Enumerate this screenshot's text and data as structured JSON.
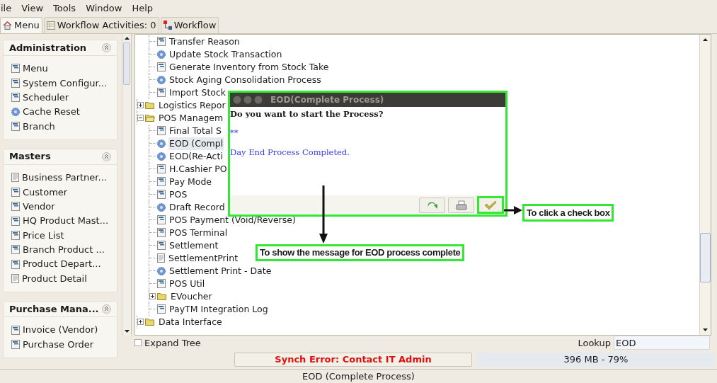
{
  "menu_bar": [
    "ile",
    "View",
    "Tools",
    "Window",
    "Help"
  ],
  "tabs": [
    {
      "label": "Menu",
      "kind": "home",
      "selected": true
    },
    {
      "label": "Workflow Activities: 0",
      "kind": "table",
      "selected": false
    },
    {
      "label": "Workflow",
      "kind": "workflow",
      "selected": false
    }
  ],
  "sidebar": [
    {
      "title": "Administration",
      "expanded": true,
      "items": [
        {
          "label": "Menu",
          "kind": "form"
        },
        {
          "label": "System Configur...",
          "kind": "form"
        },
        {
          "label": "Scheduler",
          "kind": "form"
        },
        {
          "label": "Cache Reset",
          "kind": "process"
        },
        {
          "label": "Branch",
          "kind": "form"
        }
      ]
    },
    {
      "title": "Masters",
      "expanded": true,
      "items": [
        {
          "label": "Business Partner...",
          "kind": "report"
        },
        {
          "label": "Customer",
          "kind": "form"
        },
        {
          "label": "Vendor",
          "kind": "form"
        },
        {
          "label": "HQ Product Mast...",
          "kind": "form"
        },
        {
          "label": "Price List",
          "kind": "form"
        },
        {
          "label": "Branch Product ...",
          "kind": "form"
        },
        {
          "label": "Product Depart...",
          "kind": "form"
        },
        {
          "label": "Product Detail",
          "kind": "report"
        }
      ]
    },
    {
      "title": "Purchase Mana...",
      "expanded": true,
      "items": [
        {
          "label": "Invoice (Vendor)",
          "kind": "form"
        },
        {
          "label": "Purchase Order",
          "kind": "form"
        }
      ]
    }
  ],
  "tree": {
    "continued_items": [
      {
        "label": "Transfer Reason",
        "kind": "form",
        "selected": false
      },
      {
        "label": "Update Stock Transaction",
        "kind": "process",
        "selected": false
      },
      {
        "label": "Generate Inventory from Stock Take",
        "kind": "form",
        "selected": false
      },
      {
        "label": "Stock Aging Consolidation Process",
        "kind": "process",
        "selected": false
      },
      {
        "label": "Import Stock",
        "kind": "form",
        "selected": false
      }
    ],
    "nodes": [
      {
        "label": "Logistics Repor",
        "kind": "folder",
        "expanded": false,
        "selected": false
      },
      {
        "label": "POS Managem",
        "kind": "folder",
        "expanded": true,
        "selected": false,
        "children": [
          {
            "label": "Final Total S",
            "kind": "form",
            "selected": false
          },
          {
            "label": "EOD (Compl",
            "kind": "process",
            "selected": true
          },
          {
            "label": "EOD(Re-Acti",
            "kind": "process",
            "selected": false
          },
          {
            "label": "H.Cashier PO",
            "kind": "form",
            "selected": false
          },
          {
            "label": "Pay Mode",
            "kind": "form",
            "selected": false
          },
          {
            "label": "POS",
            "kind": "form",
            "selected": false
          },
          {
            "label": "Draft Record",
            "kind": "process",
            "selected": false
          },
          {
            "label": "POS Payment (Void/Reverse)",
            "kind": "form",
            "selected": false
          },
          {
            "label": "POS Terminal",
            "kind": "form",
            "selected": false
          },
          {
            "label": "Settlement",
            "kind": "form",
            "selected": false
          },
          {
            "label": "SettlementPrint",
            "kind": "report",
            "selected": false
          },
          {
            "label": "Settlement Print - Date",
            "kind": "process",
            "selected": false
          },
          {
            "label": "POS Util",
            "kind": "form",
            "selected": false
          },
          {
            "label": "EVoucher",
            "kind": "folder",
            "expanded": false,
            "selected": false
          },
          {
            "label": "PayTM Integration Log",
            "kind": "form",
            "selected": false
          }
        ]
      },
      {
        "label": "Data Interface",
        "kind": "folder",
        "expanded": false,
        "selected": false
      }
    ]
  },
  "expand_tree": {
    "label": "Expand Tree",
    "checked": false
  },
  "lookup": {
    "label": "Lookup",
    "value": "EOD"
  },
  "status": {
    "error": "Synch Error: Contact IT Admin",
    "memory": "396 MB - 79%",
    "title": "EOD (Complete Process)"
  },
  "dialog": {
    "title": "EOD(Complete Process)",
    "question": "Do you want to start the Process?",
    "marker": "**",
    "message": "Day End Process Completed."
  },
  "annotations": [
    "To show the message for EOD process complete",
    "To click a check box"
  ]
}
